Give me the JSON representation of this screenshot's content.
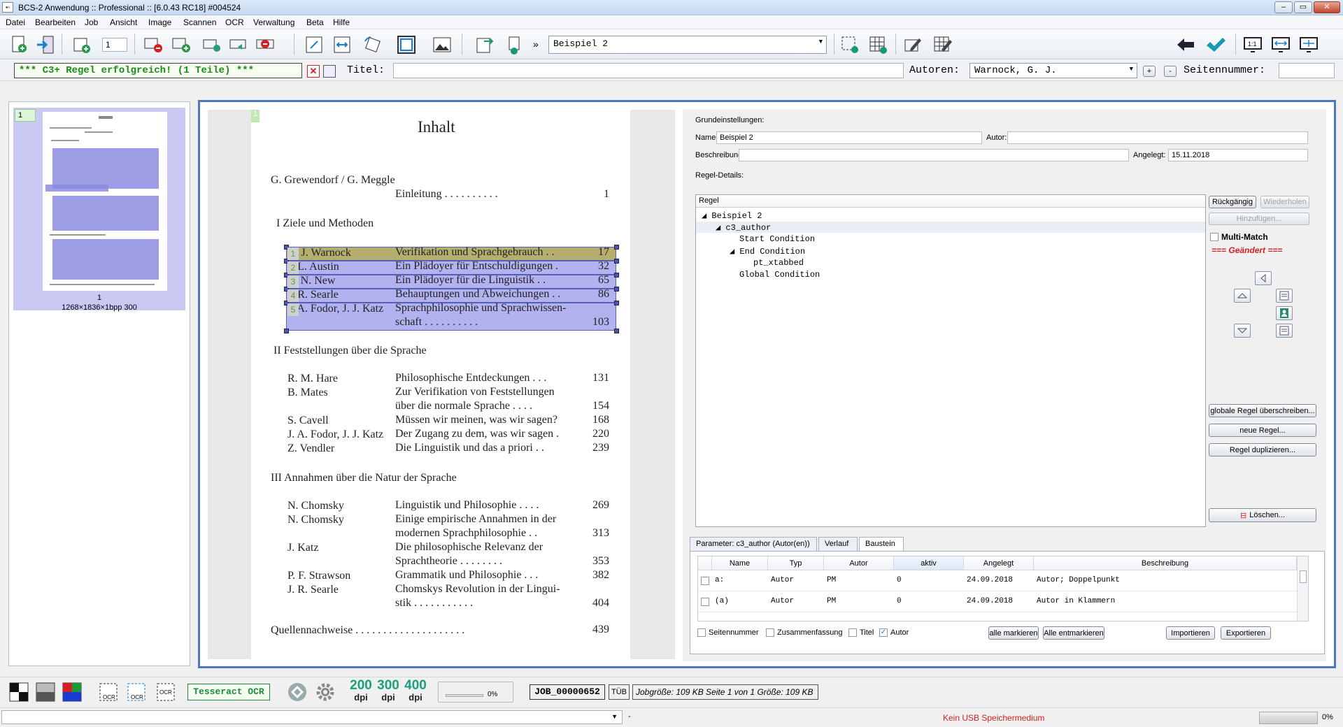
{
  "window": {
    "title": "BCS-2 Anwendung :: Professional :: [6.0.43 RC18]   #004524",
    "min": "–",
    "max": "▭",
    "close": "✕"
  },
  "menu": [
    "Datei",
    "Bearbeiten",
    "Job",
    "Ansicht",
    "Image",
    "Scannen",
    "OCR",
    "Verwaltung",
    "Beta",
    "Hilfe"
  ],
  "toolbar": {
    "counter": "1",
    "more": "»",
    "profile": "Beispiel 2"
  },
  "ruleline": {
    "status": "*** C3+ Regel erfolgreich! (1 Teile) ***",
    "titel_label": "Titel:",
    "autoren_label": "Autoren:",
    "autoren_value": "Warnock, G. J.",
    "plus": "+",
    "minus": "-",
    "seiten_label": "Seitennummer:"
  },
  "thumbnail": {
    "index": "1",
    "page_label": "1",
    "info": "1268×1836×1bpp 300"
  },
  "page": {
    "marker": "1",
    "title": "Inhalt",
    "intro_authors": "G. Grewendorf / G. Meggle",
    "intro_title": "Einleitung . . . . . . . . . .",
    "intro_page": "1",
    "sec1": "I   Ziele und Methoden",
    "s1": [
      {
        "a": "G. J. Warnock",
        "t": "Verifikation und Sprachgebrauch . .",
        "p": "17",
        "tag": "1"
      },
      {
        "a": "J. L. Austin",
        "t": "Ein Plädoyer für Entschuldigungen .",
        "p": "32",
        "tag": "2"
      },
      {
        "a": "C. N. New",
        "t": "Ein Plädoyer für die Linguistik . .",
        "p": "65",
        "tag": "3"
      },
      {
        "a": "J. R. Searle",
        "t": "Behauptungen und Abweichungen . .",
        "p": "86",
        "tag": "4"
      },
      {
        "a": "J. A. Fodor, J. J. Katz",
        "t": "Sprachphilosophie und Sprachwissen-",
        "p": "",
        "tag": "5"
      }
    ],
    "s1_cont": "schaft . . . . . . . . . .",
    "s1_cont_page": "103",
    "sec2": "II   Feststellungen über die Sprache",
    "s2": [
      {
        "a": "R. M. Hare",
        "t": "Philosophische Entdeckungen . . .",
        "p": "131"
      },
      {
        "a": "B. Mates",
        "t": "Zur Verifikation von Feststellungen",
        "p": ""
      },
      {
        "a": "",
        "t": "über die normale Sprache . . . .",
        "p": "154"
      },
      {
        "a": "S. Cavell",
        "t": "Müssen wir meinen, was wir sagen?",
        "p": "168"
      },
      {
        "a": "J. A. Fodor, J. J. Katz",
        "t": "Der Zugang zu dem, was wir sagen .",
        "p": "220"
      },
      {
        "a": "Z. Vendler",
        "t": "Die Linguistik und das a priori . .",
        "p": "239"
      }
    ],
    "sec3": "III   Annahmen über die Natur der Sprache",
    "s3": [
      {
        "a": "N. Chomsky",
        "t": "Linguistik und Philosophie . . . .",
        "p": "269"
      },
      {
        "a": "N. Chomsky",
        "t": "Einige empirische Annahmen in der",
        "p": ""
      },
      {
        "a": "",
        "t": "modernen Sprachphilosophie . .",
        "p": "313"
      },
      {
        "a": "J. Katz",
        "t": "Die philosophische Relevanz der",
        "p": ""
      },
      {
        "a": "",
        "t": "Sprachtheorie . . . . . . . .",
        "p": "353"
      },
      {
        "a": "P. F. Strawson",
        "t": "Grammatik und Philosophie . . .",
        "p": "382"
      },
      {
        "a": "J. R. Searle",
        "t": "Chomskys Revolution in der Lingui-",
        "p": ""
      },
      {
        "a": "",
        "t": "stik . . . . . . . . . . .",
        "p": "404"
      }
    ],
    "sources": "Quellennachweise . . . . . . . . . . . . . . . . . . . .",
    "sources_page": "439"
  },
  "settings": {
    "grund": "Grundeinstellungen:",
    "name_label": "Name:",
    "name_value": "Beispiel 2",
    "autor_label": "Autor:",
    "autor_value": "",
    "beschr_label": "Beschreibung:",
    "angelegt_label": "Angelegt:",
    "angelegt_value": "15.11.2018",
    "details": "Regel-Details:",
    "tree_header": "Regel",
    "tree": [
      {
        "t": "◢ Beispiel 2",
        "lvl": 0
      },
      {
        "t": "◢ c3_author",
        "lvl": 1
      },
      {
        "t": "Start Condition",
        "lvl": 2
      },
      {
        "t": "◢ End Condition",
        "lvl": 2
      },
      {
        "t": "pt_xtabbed",
        "lvl": 3
      },
      {
        "t": "Global Condition",
        "lvl": 2
      }
    ],
    "undo": "Rückgängig",
    "redo": "Wiederholen",
    "add": "Hinzufügen...",
    "multimatch": "Multi-Match",
    "changed": "=== Geändert ===",
    "override": "globale Regel überschreiben...",
    "new_rule": "neue Regel...",
    "dup_rule": "Regel duplizieren...",
    "delete": "Löschen..."
  },
  "tabs": [
    "Parameter: c3_author (Autor(en))",
    "Verlauf",
    "Baustein"
  ],
  "grid": {
    "headers": [
      "Name",
      "Typ",
      "Autor",
      "aktiv",
      "Angelegt",
      "Beschreibung"
    ],
    "rows": [
      {
        "name": "a:",
        "typ": "Autor",
        "autor": "PM",
        "aktiv": "0",
        "angelegt": "24.09.2018",
        "beschr": "Autor; Doppelpunkt"
      },
      {
        "name": "(a)",
        "typ": "Autor",
        "autor": "PM",
        "aktiv": "0",
        "angelegt": "24.09.2018",
        "beschr": "Autor in Klammern"
      }
    ]
  },
  "filters": {
    "seitennummer": "Seitennummer",
    "zusammenfassung": "Zusammenfassung",
    "titel": "Titel",
    "autor": "Autor",
    "mark_all": "alle markieren",
    "unmark_all": "Alle entmarkieren",
    "import": "Importieren",
    "export": "Exportieren"
  },
  "bottom": {
    "ocr_engine": "Tesseract OCR",
    "dpi": [
      "200",
      "300",
      "400"
    ],
    "dpi_unit": "dpi",
    "progress": "0%",
    "job": "JOB_00000652",
    "tub": "TÜB",
    "jobinfo": "Jobgröße: 109 KB Seite 1 von 1 Größe: 109 KB"
  },
  "status": {
    "usb": "Kein USB Speichermedium",
    "progress": "0%",
    "dash": "-"
  },
  "colors": {
    "accent": "#4a78c6",
    "ok_green": "#1a8a1a",
    "alert_red": "#d42020",
    "highlight": "#8282e6"
  }
}
